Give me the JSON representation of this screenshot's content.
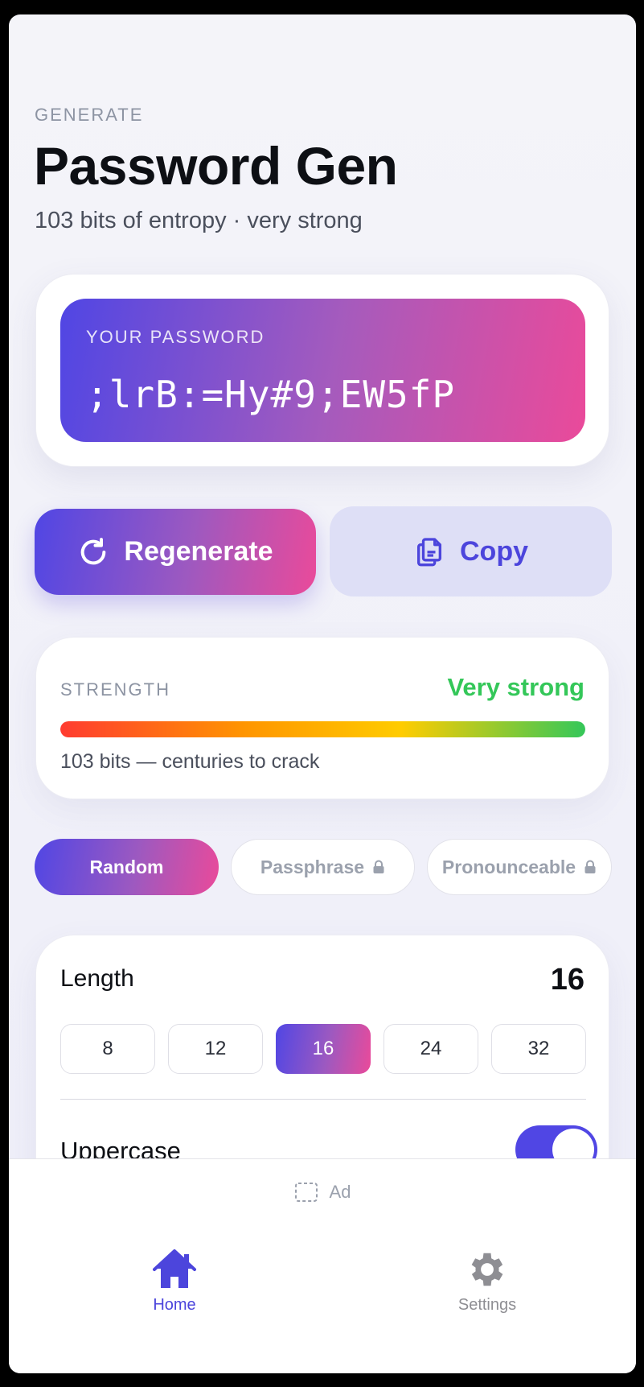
{
  "header": {
    "eyebrow": "GENERATE",
    "title": "Password Gen",
    "subtitle": "103 bits of entropy · very strong"
  },
  "password_card": {
    "label": "YOUR PASSWORD",
    "value": ";lrB:=Hy#9;EW5fP"
  },
  "actions": {
    "regenerate_label": "Regenerate",
    "copy_label": "Copy"
  },
  "strength": {
    "label": "STRENGTH",
    "value": "Very strong",
    "value_color": "#34c759",
    "level_fraction": 1.0,
    "note": "103 bits — centuries to crack"
  },
  "modes": [
    {
      "label": "Random",
      "active": true,
      "locked": false
    },
    {
      "label": "Passphrase",
      "active": false,
      "locked": true
    },
    {
      "label": "Pronounceable",
      "active": false,
      "locked": true
    }
  ],
  "settings": {
    "length_label": "Length",
    "length_value": "16",
    "length_options": [
      "8",
      "12",
      "16",
      "24",
      "32"
    ],
    "selected_length": "16",
    "uppercase_label": "Uppercase",
    "uppercase_on": true
  },
  "ad": {
    "label": "Ad"
  },
  "tabbar": {
    "home_label": "Home",
    "settings_label": "Settings",
    "active_color": "#4c45dc",
    "inactive_color": "#8e8e93"
  },
  "colors": {
    "accent": "#5046e4",
    "gradient_end": "#ea4a9a"
  }
}
